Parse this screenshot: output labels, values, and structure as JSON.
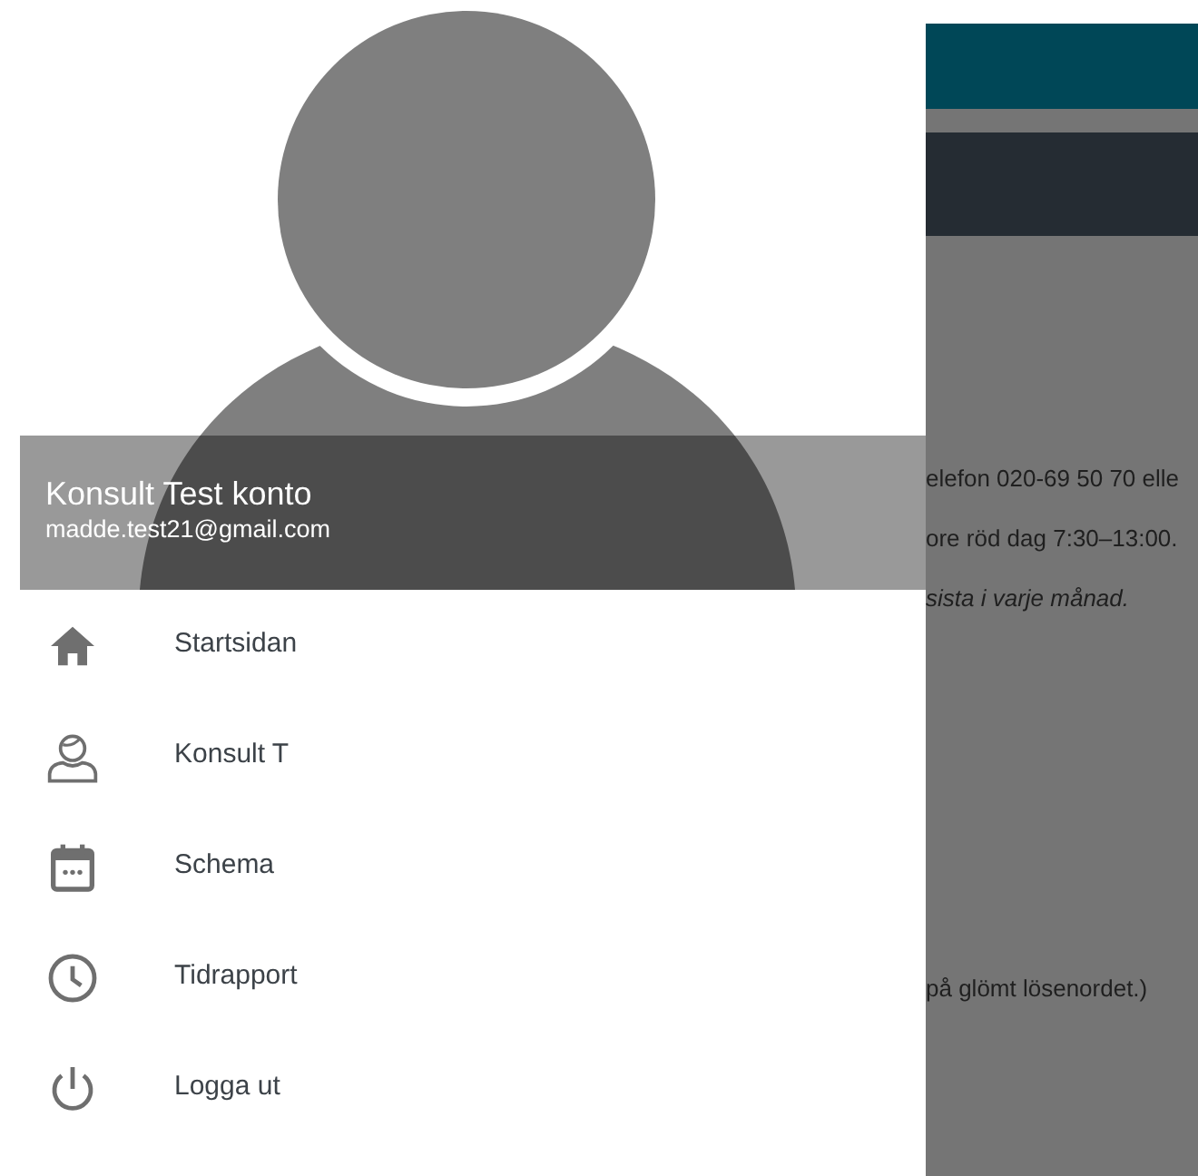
{
  "drawer": {
    "profile": {
      "name": "Konsult Test konto",
      "email": "madde.test21@gmail.com"
    },
    "menu": [
      {
        "kind": "home",
        "label": "Startsidan"
      },
      {
        "kind": "user",
        "label": "Konsult T"
      },
      {
        "kind": "calendar",
        "label": "Schema"
      },
      {
        "kind": "clock",
        "label": "Tidrapport"
      },
      {
        "kind": "power",
        "label": "Logga ut"
      }
    ]
  },
  "background_page": {
    "lines": [
      {
        "text": "elefon 020-69 50 70 elle",
        "italic": false
      },
      {
        "text": "ore röd dag 7:30–13:00.",
        "italic": false
      },
      {
        "text": "sista i varje månad.",
        "italic": true
      },
      {
        "text": "på glömt lösenordet.)",
        "italic": false
      }
    ]
  }
}
